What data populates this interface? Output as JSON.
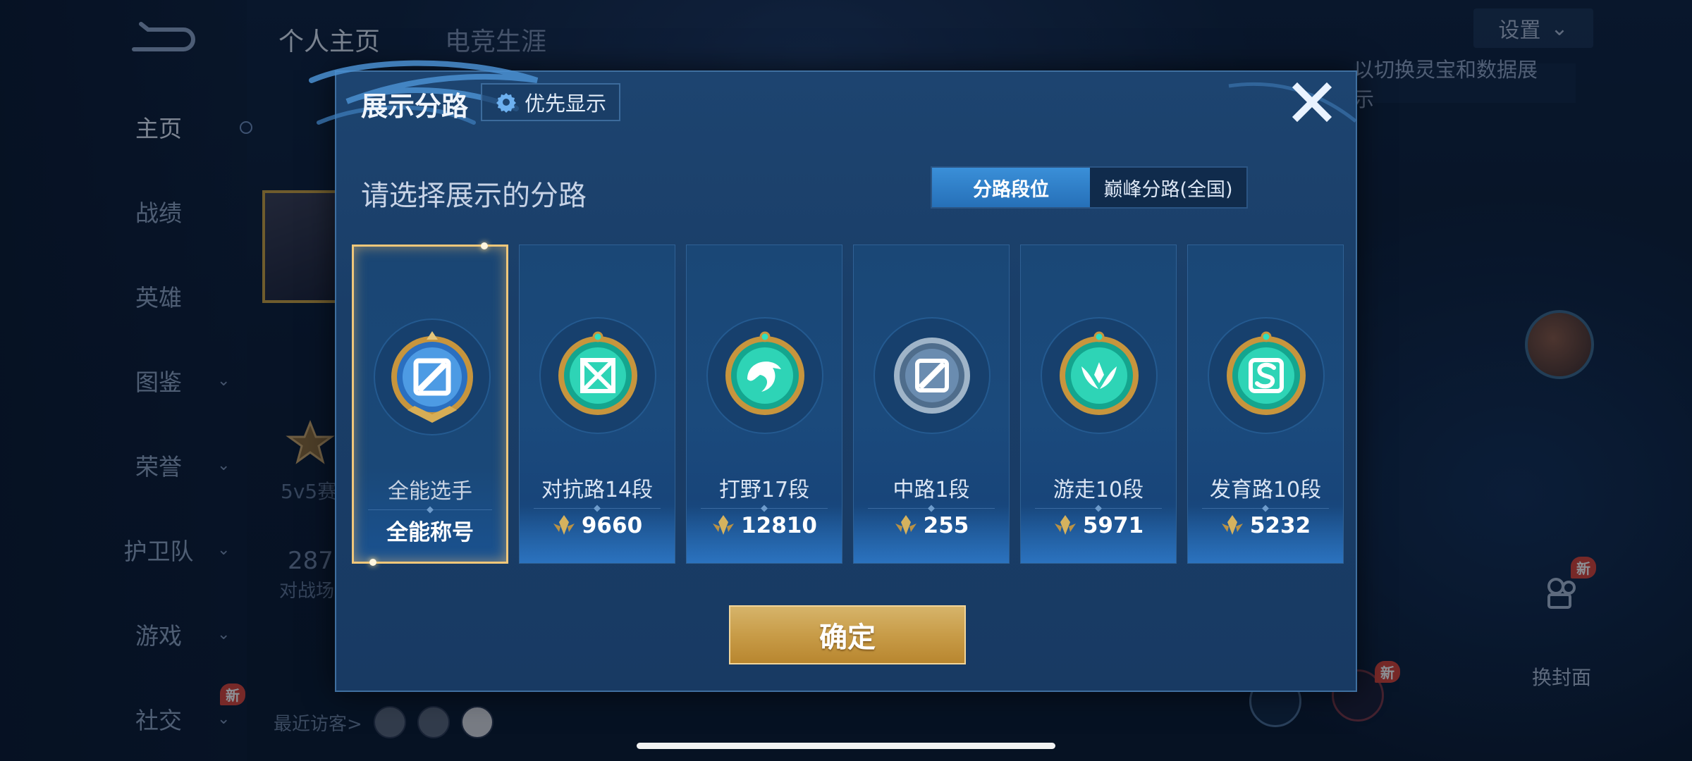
{
  "background": {
    "sidebar": {
      "items": [
        {
          "label": "主页",
          "active": true,
          "chevron": false
        },
        {
          "label": "战绩",
          "chevron": false
        },
        {
          "label": "英雄",
          "chevron": false
        },
        {
          "label": "图鉴",
          "chevron": true
        },
        {
          "label": "荣誉",
          "chevron": true
        },
        {
          "label": "护卫队",
          "chevron": true
        },
        {
          "label": "游戏",
          "chevron": true
        },
        {
          "label": "社交",
          "chevron": true,
          "badge": "新"
        }
      ]
    },
    "top_tabs": [
      "个人主页",
      "电竞生涯"
    ],
    "settings_label": "设置",
    "hint_text": "以切换灵宝和数据展示",
    "stat_label_1": "5v5赛",
    "stat_number": "287",
    "stat_label_2": "对战场",
    "recent_visitors_label": "最近访客>",
    "cover_label": "换封面",
    "new_badge": "新"
  },
  "modal": {
    "title": "展示分路",
    "priority_label": "优先显示",
    "subtitle": "请选择展示的分路",
    "tabs": [
      {
        "label": "分路段位",
        "active": true
      },
      {
        "label": "巅峰分路(全国)",
        "active": false
      }
    ],
    "cards": [
      {
        "name": "全能选手",
        "value": "全能称号",
        "selected": true,
        "emblem": "all-round-emblem"
      },
      {
        "name": "对抗路14段",
        "value": "9660",
        "selected": false,
        "emblem": "clash-lane-emblem"
      },
      {
        "name": "打野17段",
        "value": "12810",
        "selected": false,
        "emblem": "jungle-emblem"
      },
      {
        "name": "中路1段",
        "value": "255",
        "selected": false,
        "emblem": "mid-lane-emblem"
      },
      {
        "name": "游走10段",
        "value": "5971",
        "selected": false,
        "emblem": "roam-emblem"
      },
      {
        "name": "发育路10段",
        "value": "5232",
        "selected": false,
        "emblem": "farm-lane-emblem"
      }
    ],
    "confirm_label": "确定"
  },
  "colors": {
    "accent_gold": "#c89c48",
    "tab_active_blue": "#2f80c8",
    "selected_border": "#f0c77a",
    "emblem_green": "#1fbfa4"
  }
}
